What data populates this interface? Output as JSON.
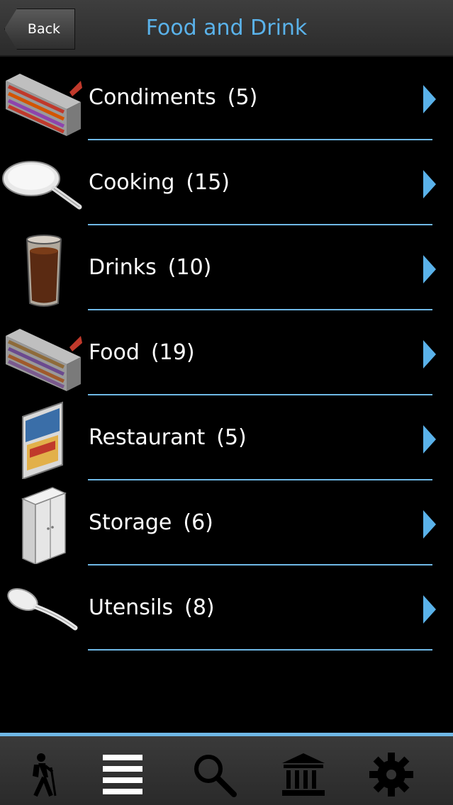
{
  "navbar": {
    "back_label": "Back",
    "title": "Food and Drink"
  },
  "items": [
    {
      "label": "Condiments",
      "count": "(5)",
      "icon": "shelf-icon"
    },
    {
      "label": "Cooking",
      "count": "(15)",
      "icon": "frying-pan-icon"
    },
    {
      "label": "Drinks",
      "count": "(10)",
      "icon": "glass-icon"
    },
    {
      "label": "Food",
      "count": "(19)",
      "icon": "shelf-icon"
    },
    {
      "label": "Restaurant",
      "count": "(5)",
      "icon": "cafe-sign-icon"
    },
    {
      "label": "Storage",
      "count": "(6)",
      "icon": "cabinet-icon"
    },
    {
      "label": "Utensils",
      "count": "(8)",
      "icon": "spoon-icon"
    }
  ],
  "tabbar": {
    "tabs": [
      "hiker-icon",
      "list-icon",
      "search-icon",
      "museum-icon",
      "gear-icon"
    ]
  },
  "colors": {
    "accent": "#5ab2ea",
    "separator": "#6fb8e6",
    "background": "#000000"
  }
}
